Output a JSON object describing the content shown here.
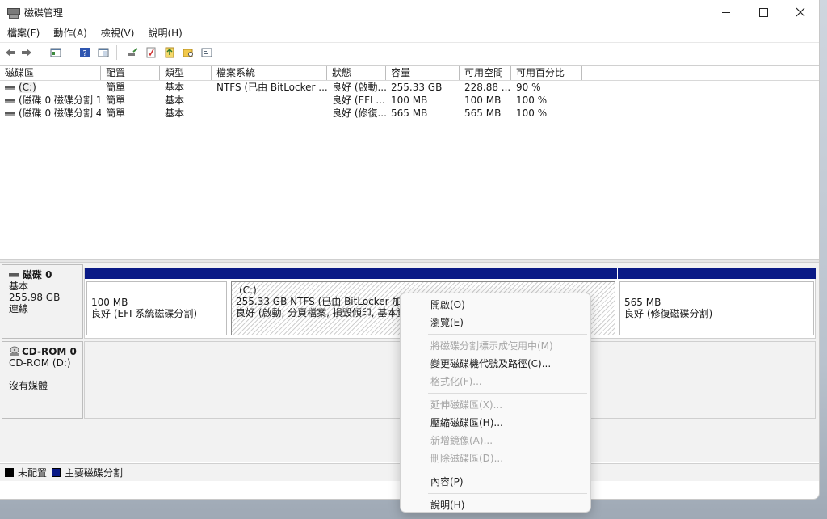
{
  "window": {
    "title": "磁碟管理"
  },
  "menu": [
    "檔案(F)",
    "動作(A)",
    "檢視(V)",
    "說明(H)"
  ],
  "toolbar": {
    "icons": [
      "back-arrow",
      "forward-arrow",
      "console-tree",
      "help",
      "properties-pane",
      "connect-drive",
      "check",
      "export",
      "folder-search",
      "console-view"
    ]
  },
  "volume_list": {
    "columns": [
      "磁碟區",
      "配置",
      "類型",
      "檔案系統",
      "狀態",
      "容量",
      "可用空間",
      "可用百分比"
    ],
    "rows": [
      {
        "volume": "(C:)",
        "layout": "簡單",
        "type": "基本",
        "fs": "NTFS (已由 BitLocker ...",
        "status": "良好 (啟動...",
        "capacity": "255.33 GB",
        "free": "228.88 ...",
        "percent": "90 %"
      },
      {
        "volume": "(磁碟 0 磁碟分割 1)",
        "layout": "簡單",
        "type": "基本",
        "fs": "",
        "status": "良好 (EFI ...",
        "capacity": "100 MB",
        "free": "100 MB",
        "percent": "100 %"
      },
      {
        "volume": "(磁碟 0 磁碟分割 4)",
        "layout": "簡單",
        "type": "基本",
        "fs": "",
        "status": "良好 (修復...",
        "capacity": "565 MB",
        "free": "565 MB",
        "percent": "100 %"
      }
    ]
  },
  "disks": {
    "disk0": {
      "name": "磁碟 0",
      "type": "基本",
      "size": "255.98 GB",
      "state": "連線",
      "partitions": [
        {
          "line1": "100 MB",
          "line2": "良好 (EFI 系統磁碟分割)"
        },
        {
          "title": "(C:)",
          "line1": "255.33 GB NTFS (已由 BitLocker 加密)",
          "line2": "良好 (啟動, 分頁檔案, 損毀傾印, 基本資料"
        },
        {
          "line1": "565 MB",
          "line2": "良好 (修復磁碟分割)"
        }
      ]
    },
    "cdrom": {
      "name": "CD-ROM 0",
      "drive": "CD-ROM (D:)",
      "media": "沒有媒體"
    }
  },
  "legend": {
    "unallocated": "未配置",
    "primary": "主要磁碟分割",
    "unallocated_color": "#000000",
    "primary_color": "#0a1a86"
  },
  "context_menu": {
    "open": "開啟(O)",
    "explore": "瀏覽(E)",
    "mark_active": "將磁碟分割標示成使用中(M)",
    "change_letter": "變更磁碟機代號及路徑(C)...",
    "format": "格式化(F)...",
    "extend": "延伸磁碟區(X)...",
    "shrink": "壓縮磁碟區(H)...",
    "add_mirror": "新增鏡像(A)...",
    "delete": "刪除磁碟區(D)...",
    "properties": "內容(P)",
    "help": "說明(H)"
  }
}
